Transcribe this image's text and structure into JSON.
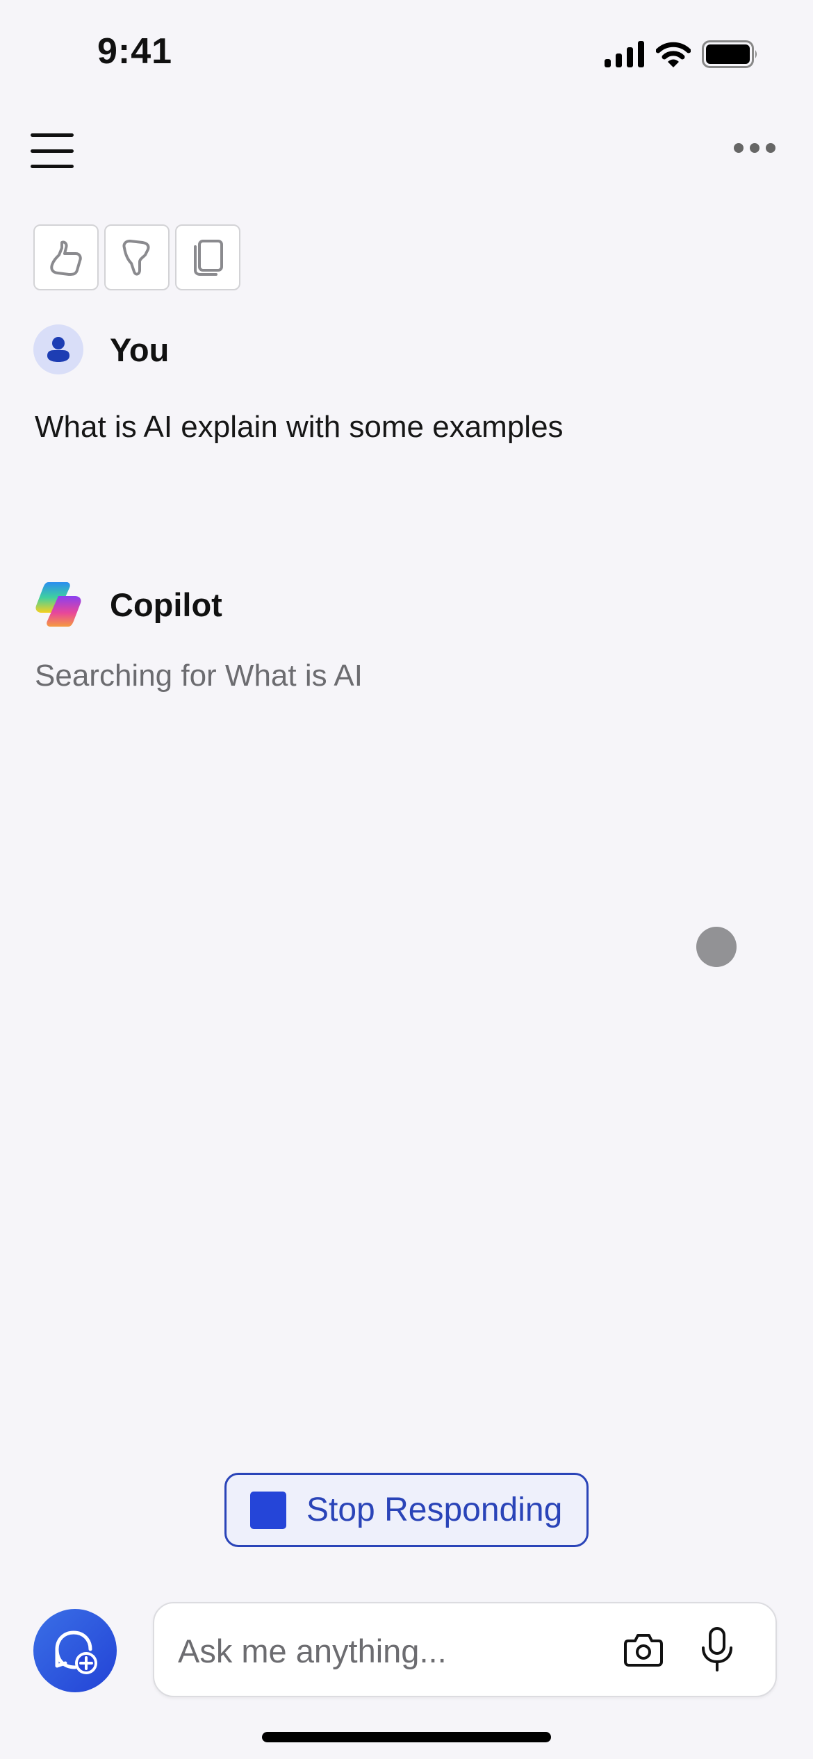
{
  "status_bar": {
    "time": "9:41",
    "icons": [
      "cellular-signal-icon",
      "wifi-icon",
      "battery-icon"
    ]
  },
  "nav": {
    "menu_icon": "hamburger-menu-icon",
    "more_icon": "more-options-icon"
  },
  "feedback_actions": [
    {
      "name": "thumbs-up",
      "icon": "thumbs-up-icon"
    },
    {
      "name": "thumbs-down",
      "icon": "thumbs-down-icon"
    },
    {
      "name": "copy",
      "icon": "copy-icon"
    }
  ],
  "conversation": {
    "user": {
      "name": "You",
      "message": "What is AI explain with some examples"
    },
    "assistant": {
      "name": "Copilot",
      "status": "Searching for What is AI"
    }
  },
  "stop_button": {
    "label": "Stop Responding"
  },
  "composer": {
    "placeholder": "Ask me anything...",
    "value": ""
  },
  "colors": {
    "accent": "#2545d8",
    "background": "#f6f5f9",
    "muted_text": "#6c6c70"
  }
}
